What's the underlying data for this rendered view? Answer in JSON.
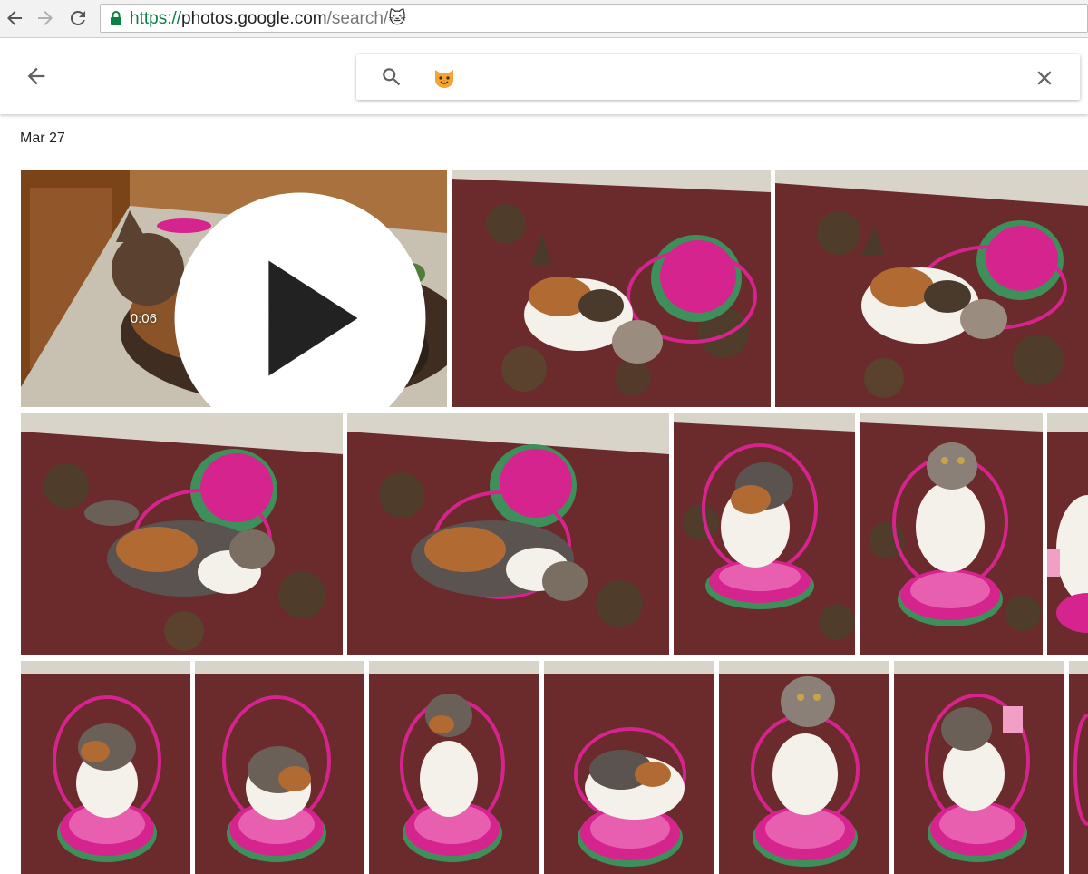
{
  "browser": {
    "url_scheme": "https://",
    "url_host": "photos.google.com",
    "url_path": "/search/",
    "url_emoji": "🐱"
  },
  "search": {
    "query_emoji": "🐱"
  },
  "section": {
    "date": "Mar 27"
  },
  "photos": [
    {
      "kind": "video",
      "duration": "0:06",
      "scene": "cat-on-carpet-by-door"
    },
    {
      "kind": "photo",
      "scene": "kitten-with-pink-basket-on-rug"
    },
    {
      "kind": "photo",
      "scene": "kitten-with-pink-basket-on-rug"
    },
    {
      "kind": "photo",
      "scene": "cat-lying-under-pink-basket"
    },
    {
      "kind": "photo",
      "scene": "cat-lying-under-pink-basket"
    },
    {
      "kind": "photo",
      "scene": "cat-standing-in-pink-basket"
    },
    {
      "kind": "photo",
      "scene": "cat-standing-in-pink-basket"
    },
    {
      "kind": "photo",
      "scene": "cat-standing-in-pink-basket"
    },
    {
      "kind": "photo",
      "scene": "cat-standing-in-pink-basket"
    },
    {
      "kind": "photo",
      "scene": "cat-standing-in-pink-basket"
    },
    {
      "kind": "photo",
      "scene": "cat-standing-in-pink-basket"
    },
    {
      "kind": "photo",
      "scene": "cat-standing-in-pink-basket"
    },
    {
      "kind": "photo",
      "scene": "cat-standing-in-pink-basket"
    },
    {
      "kind": "photo",
      "scene": "cat-standing-in-pink-basket"
    },
    {
      "kind": "photo",
      "scene": "cat-standing-in-pink-basket"
    }
  ],
  "colors": {
    "rug": "#6b2a2c",
    "rug_pattern": "#3e4a2a",
    "basket": "#d6248f",
    "basket_green": "#3f8f5a",
    "fur_dark": "#4a3a2c",
    "fur_orange": "#b06a32",
    "fur_white": "#f4f0ea",
    "floor": "#c9c0b2",
    "wood": "#8a4e22"
  }
}
